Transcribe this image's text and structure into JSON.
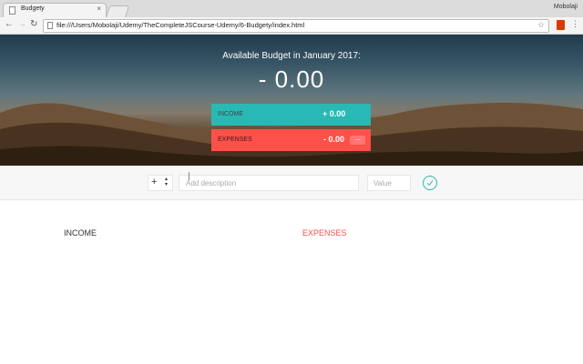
{
  "browser": {
    "tab_title": "Budgety",
    "tab_close": "×",
    "profile_name": "Mobolaji",
    "url": "file:///Users/Mobolaji/Udemy/TheCompleteJSCourse-Udemy/6-Budgety/index.html",
    "back_glyph": "←",
    "forward_glyph": "→",
    "reload_glyph": "↻",
    "star_glyph": "☆",
    "menu_glyph": "⋮"
  },
  "budget": {
    "title": "Available Budget in January 2017:",
    "value": "- 0.00",
    "income_label": "Income",
    "income_value": "+ 0.00",
    "expenses_label": "Expenses",
    "expenses_value": "- 0.00",
    "expenses_percentage": "---"
  },
  "add": {
    "type_value": "+",
    "type_arrows": "▲▼",
    "description_placeholder": "Add description",
    "value_placeholder": "Value"
  },
  "lists": {
    "income_title": "Income",
    "expenses_title": "Expenses"
  },
  "colors": {
    "income": "#28b9b5",
    "expenses": "#ff5049"
  },
  "icons": {
    "add": "checkmark-circle-icon"
  }
}
